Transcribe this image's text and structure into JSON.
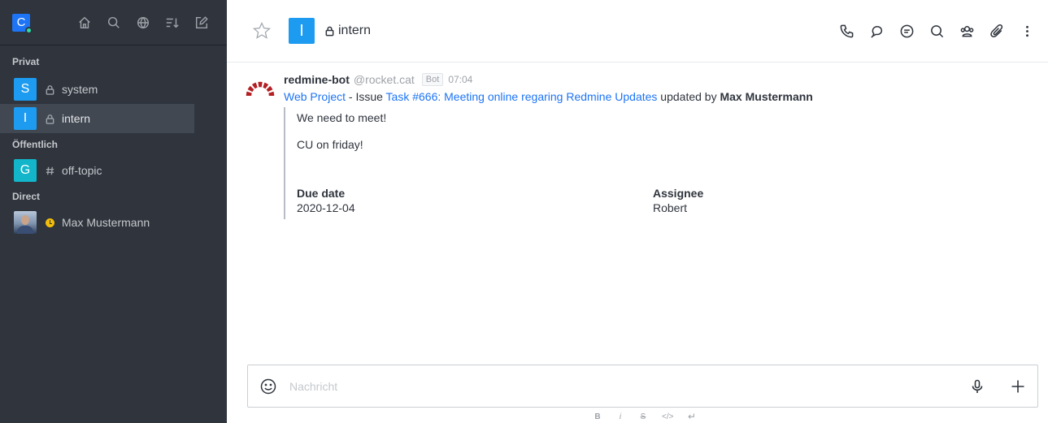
{
  "sidebar": {
    "user_initial": "C",
    "sections": {
      "private": "Privat",
      "public": "Öffentlich",
      "direct": "Direct"
    },
    "rooms": [
      {
        "initial": "S",
        "name": "system",
        "color": "#1d9bf0",
        "icon": "lock-icon"
      },
      {
        "initial": "I",
        "name": "intern",
        "color": "#1d9bf0",
        "icon": "lock-icon",
        "active": true
      },
      {
        "initial": "G",
        "name": "off-topic",
        "color": "#12b5c9",
        "icon": "hash-icon"
      }
    ],
    "direct": [
      {
        "name": "Max Mustermann",
        "status": "away"
      }
    ]
  },
  "header": {
    "room_initial": "I",
    "room_name": "intern"
  },
  "message": {
    "username": "redmine-bot",
    "handle": "@rocket.cat",
    "tag": "Bot",
    "time": "07:04",
    "project_link": "Web Project",
    "issue_prefix": " - Issue ",
    "task_link": "Task #666: Meeting online regaring Redmine Updates",
    "updated_by": " updated by ",
    "author": "Max Mustermann",
    "attachment": {
      "text_line1": "We need to meet!",
      "text_line2": "CU on friday!",
      "fields": [
        {
          "title": "Due date",
          "value": "2020-12-04"
        },
        {
          "title": "Assignee",
          "value": "Robert"
        }
      ]
    }
  },
  "composer": {
    "placeholder": "Nachricht"
  },
  "format_bar": {
    "bold": "B",
    "italic": "i",
    "strike": "S",
    "code": "</>",
    "newline": "↵"
  },
  "colors": {
    "sidebar_bg": "#2f343d",
    "accent": "#1d74f5",
    "away": "#f3be08",
    "online": "#2de0a5",
    "redmine": "#b32024"
  }
}
